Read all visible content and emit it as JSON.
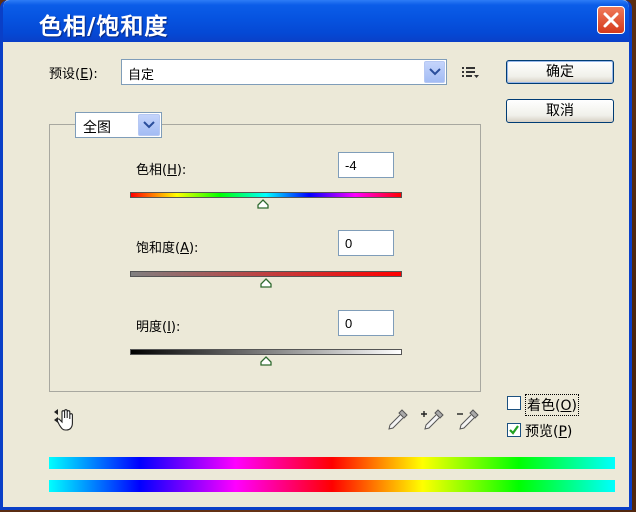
{
  "window": {
    "title": "色相/饱和度"
  },
  "preset": {
    "label_prefix": "预设(",
    "label_key": "E",
    "label_suffix": "):",
    "value": "自定"
  },
  "buttons": {
    "ok": "确定",
    "cancel": "取消"
  },
  "range": {
    "value": "全图"
  },
  "hue": {
    "label_prefix": "色相(",
    "label_key": "H",
    "label_suffix": "):",
    "value": "-4"
  },
  "saturation": {
    "label_prefix": "饱和度(",
    "label_key": "A",
    "label_suffix": "):",
    "value": "0"
  },
  "lightness": {
    "label_prefix": "明度(",
    "label_key": "I",
    "label_suffix": "):",
    "value": "0"
  },
  "colorize": {
    "label_prefix": "着色(",
    "label_key": "O",
    "label_suffix": ")",
    "checked": false
  },
  "preview": {
    "label_prefix": "预览(",
    "label_key": "P",
    "label_suffix": ")",
    "checked": true
  },
  "icons": {
    "close": "close-icon",
    "dropdown": "chevron-down-icon",
    "menu": "preset-options-icon",
    "targeted_adjust": "hand-adjust-icon",
    "eyedropper": "eyedropper-icon",
    "eyedropper_add": "eyedropper-plus-icon",
    "eyedropper_subtract": "eyedropper-minus-icon"
  },
  "slider_values": {
    "hue": -4,
    "hue_range": [
      -180,
      180
    ],
    "saturation": 0,
    "saturation_range": [
      -100,
      100
    ],
    "lightness": 0,
    "lightness_range": [
      -100,
      100
    ]
  }
}
